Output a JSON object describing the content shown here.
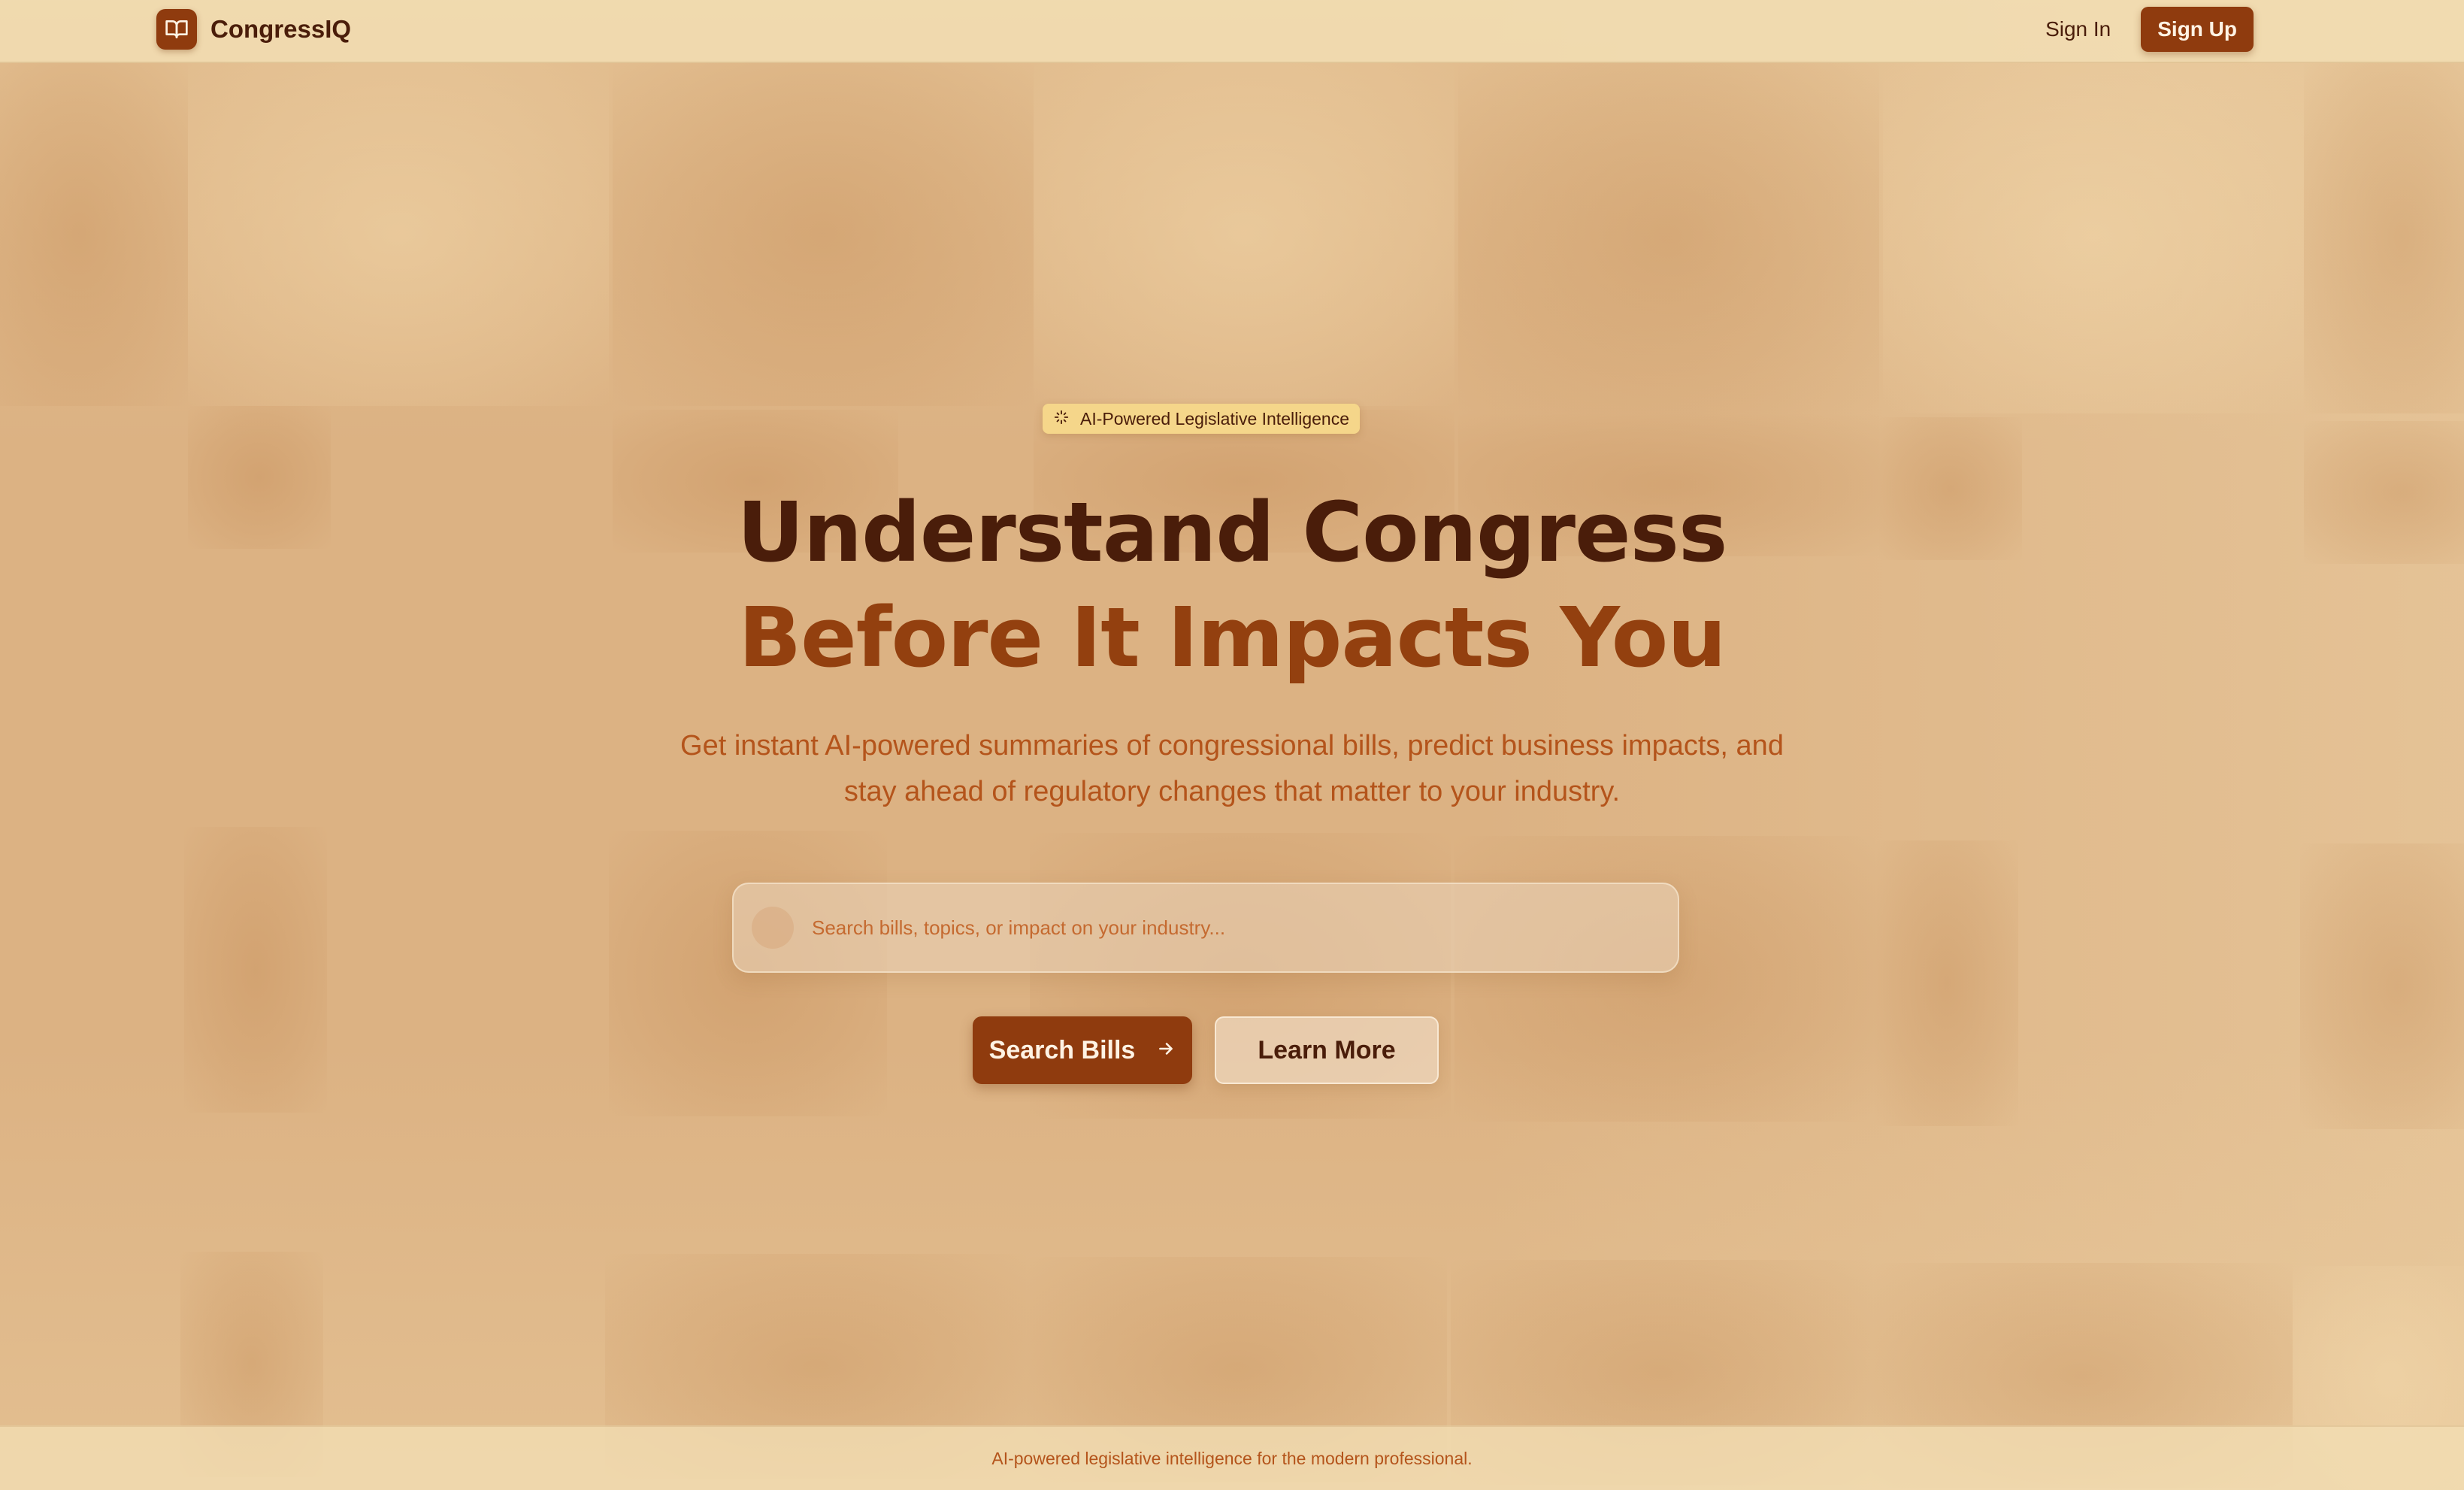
{
  "header": {
    "brand_name": "CongressIQ",
    "sign_in_label": "Sign In",
    "sign_up_label": "Sign Up"
  },
  "hero": {
    "badge_label": "AI-Powered Legislative Intelligence",
    "headline_line1": "Understand Congress",
    "headline_line2": "Before It Impacts You",
    "subtitle": "Get instant AI-powered summaries of congressional bills, predict business impacts, and stay ahead of regulatory changes that matter to your industry.",
    "search": {
      "placeholder": "Search bills, topics, or impact on your industry...",
      "value": ""
    },
    "search_button_label": "Search Bills",
    "learn_more_label": "Learn More"
  },
  "footer": {
    "text": "AI-powered legislative intelligence for the modern professional."
  },
  "icons": {
    "logo": "book-open-icon",
    "badge": "sparkles-icon",
    "search": "search-icon",
    "search_button": "arrow-right-icon"
  },
  "colors": {
    "primary": "#8f3b0e",
    "heading_dark": "#4a1d0a",
    "accent_text": "#b4541b",
    "badge_bg": "#f5d68a",
    "page_bg": "#dcb283"
  }
}
